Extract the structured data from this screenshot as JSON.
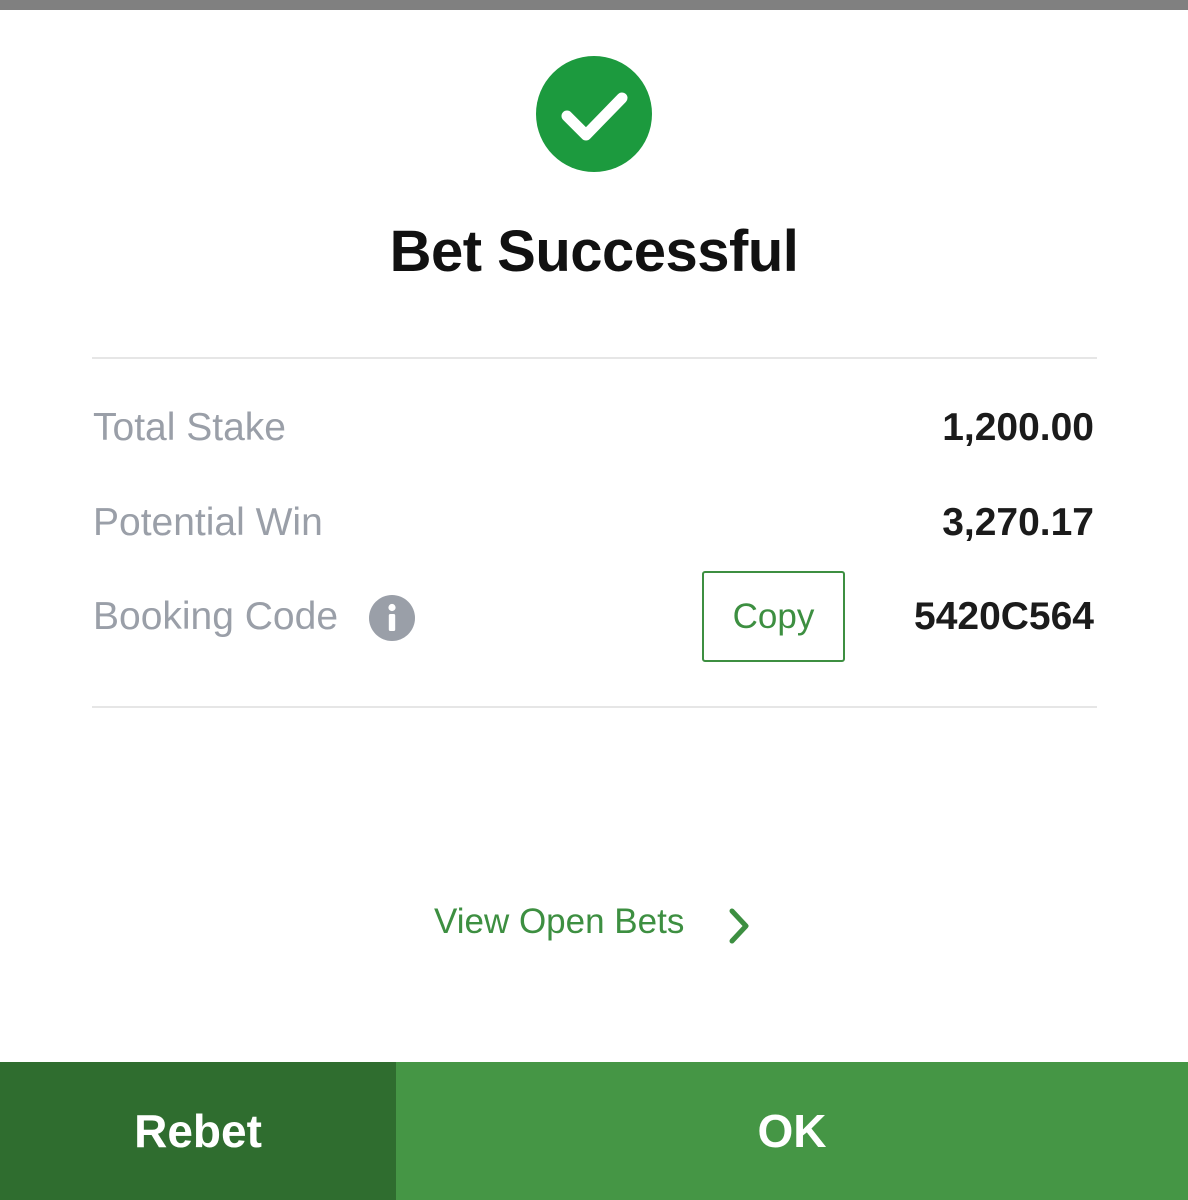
{
  "header": {
    "status_icon": "checkmark-circle-icon",
    "title": "Bet Successful"
  },
  "summary": {
    "total_stake_label": "Total Stake",
    "total_stake_value": "1,200.00",
    "potential_win_label": "Potential Win",
    "potential_win_value": "3,270.17",
    "booking_code_label": "Booking Code",
    "booking_code_info_icon": "info-icon",
    "copy_label": "Copy",
    "booking_code_value": "5420C564"
  },
  "links": {
    "view_open_bets": "View Open Bets",
    "view_open_bets_icon": "chevron-right-icon"
  },
  "footer": {
    "rebet_label": "Rebet",
    "ok_label": "OK"
  },
  "colors": {
    "success_green": "#1c9a3e",
    "accent_green": "#3d8f41",
    "rebet_bg": "#2f6d2f",
    "ok_bg": "#459645",
    "label_gray": "#9a9fa8"
  }
}
